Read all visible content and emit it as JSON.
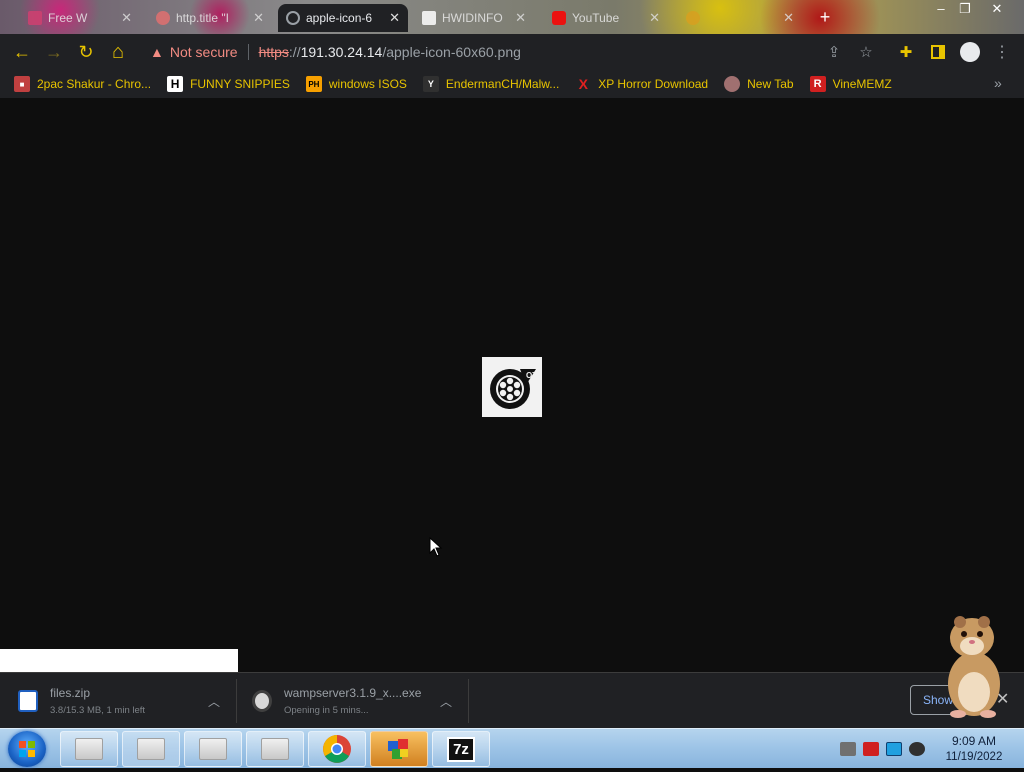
{
  "tabs": [
    {
      "title": "Free W",
      "fav_color": "#d04070",
      "active": false
    },
    {
      "title": "http.title \"I",
      "fav_color": "#e07070",
      "active": false
    },
    {
      "title": "apple-icon-6",
      "fav_color": "#9aa0a6",
      "active": true
    },
    {
      "title": "HWIDINFO",
      "fav_color": "#ffffff",
      "active": false
    },
    {
      "title": "YouTube",
      "fav_color": "#ff0000",
      "active": false
    },
    {
      "title": "",
      "fav_color": "#d8a020",
      "active": false
    }
  ],
  "toolbar": {
    "back": "←",
    "forward": "→",
    "reload": "↻",
    "home": "⌂",
    "security_label": "Not secure",
    "url_scheme": "https",
    "url_sep": "://",
    "url_host": "191.30.24.14",
    "url_path": "/apple-icon-60x60.png",
    "icons": [
      "share-icon",
      "star-icon",
      "extensions-icon",
      "side-panel-icon",
      "profile-icon",
      "menu-icon"
    ],
    "accent": "#e8c400"
  },
  "bookmarks": [
    {
      "label": "2pac Shakur - Chro...",
      "icon": "■",
      "icon_bg": "#c04040",
      "icon_fg": "#ffffff"
    },
    {
      "label": "FUNNY SNIPPIES",
      "icon": "H",
      "icon_bg": "#ffffff",
      "icon_fg": "#000000"
    },
    {
      "label": "windows ISOS",
      "icon": "PH",
      "icon_bg": "#f7a000",
      "icon_fg": "#000000"
    },
    {
      "label": "EndermanCH/Malw...",
      "icon": "Y",
      "icon_bg": "#303030",
      "icon_fg": "#ffffff"
    },
    {
      "label": "XP Horror Download",
      "icon": "X",
      "icon_bg": "transparent",
      "icon_fg": "#e02020"
    },
    {
      "label": "New Tab",
      "icon": "●",
      "icon_bg": "transparent",
      "icon_fg": "#c08080"
    },
    {
      "label": "VineMEMZ",
      "icon": "R",
      "icon_bg": "#d02020",
      "icon_fg": "#ffffff"
    }
  ],
  "bookmarks_overflow": "»",
  "content": {
    "logo_badge": "OT"
  },
  "downloads": [
    {
      "name": "files.zip",
      "status": "3.8/15.3 MB, 1 min left",
      "icon_color": "#ffffff"
    },
    {
      "name": "wampserver3.1.9_x....exe",
      "status": "Opening in 5 mins...",
      "icon_color": "#e0e0e0"
    }
  ],
  "shelf": {
    "show_all": "Show all",
    "close": "✕"
  },
  "taskbar": {
    "time": "9:09 AM",
    "date": "11/19/2022",
    "seven_zip_label": "7z"
  }
}
